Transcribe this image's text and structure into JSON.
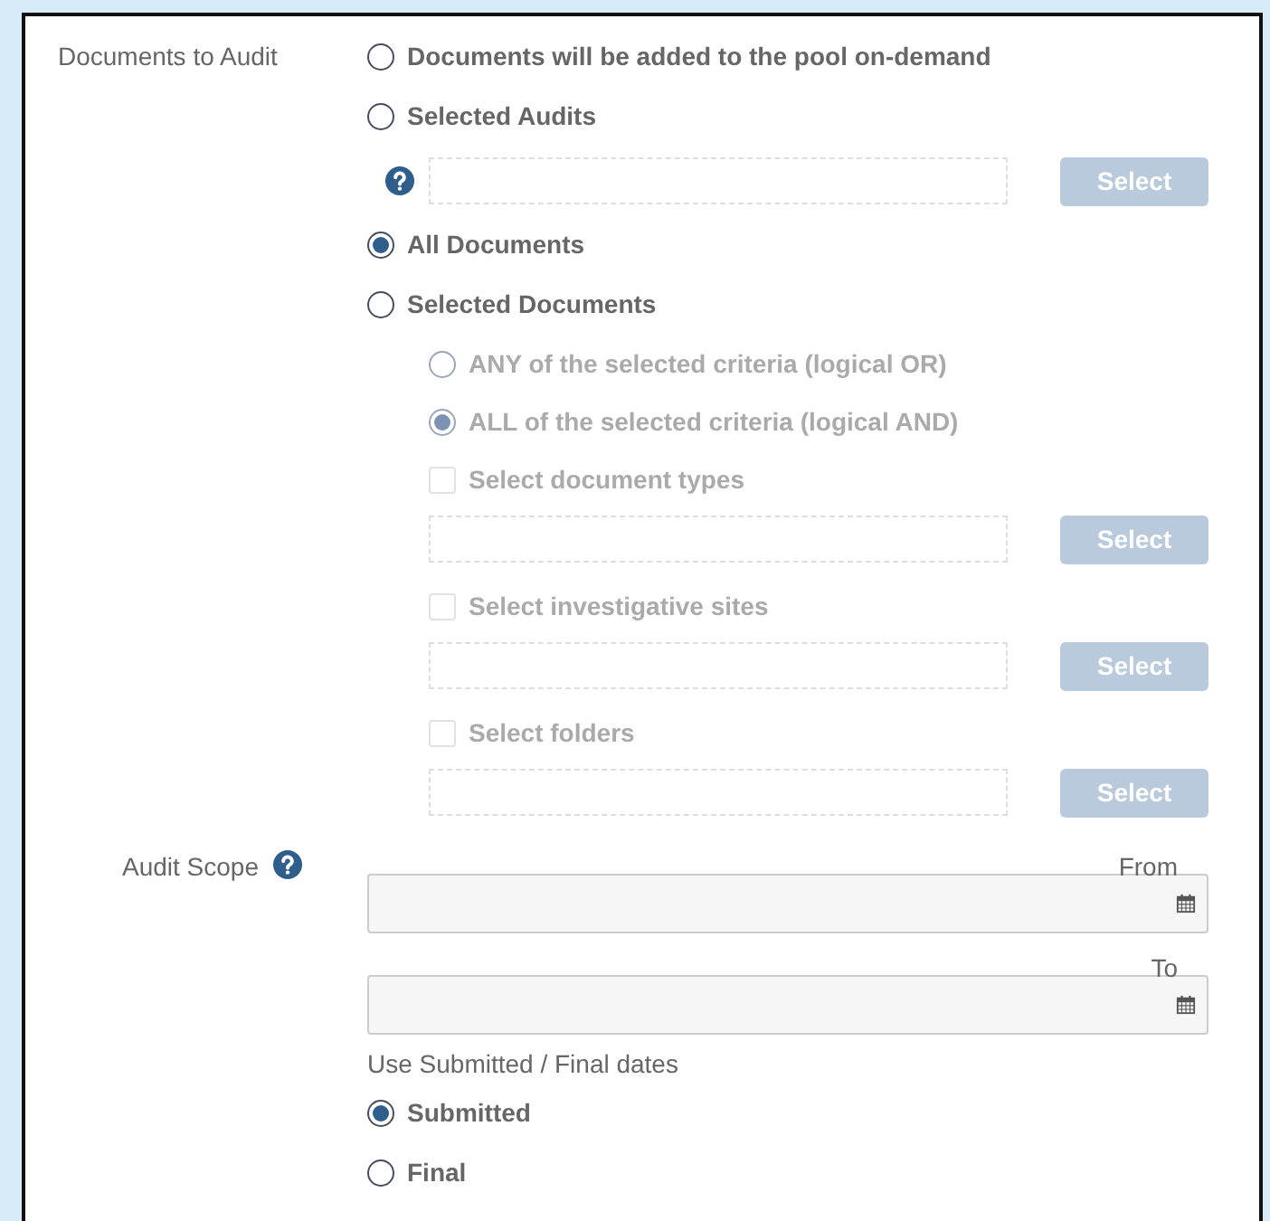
{
  "documents_to_audit": {
    "label": "Documents to Audit",
    "items": [
      {
        "kind": "radio",
        "label": "Documents will be added to the pool on-demand",
        "selected": false,
        "disabled": false
      },
      {
        "kind": "radio",
        "label": "Selected Audits",
        "selected": false,
        "disabled": false
      },
      {
        "kind": "picker",
        "help": true,
        "button": "Select"
      },
      {
        "kind": "radio",
        "label": "All Documents",
        "selected": true,
        "disabled": false
      },
      {
        "kind": "radio",
        "label": "Selected Documents",
        "selected": false,
        "disabled": false
      },
      {
        "kind": "sub-radio",
        "label": "ANY of the selected criteria (logical OR)",
        "selected": false,
        "disabled": true
      },
      {
        "kind": "sub-radio",
        "label": "ALL of the selected criteria (logical AND)",
        "selected": true,
        "disabled": true
      },
      {
        "kind": "checkbox",
        "label": "Select document types",
        "checked": false,
        "disabled": true
      },
      {
        "kind": "sub-picker",
        "help": false,
        "button": "Select"
      },
      {
        "kind": "checkbox",
        "label": "Select investigative sites",
        "checked": false,
        "disabled": true
      },
      {
        "kind": "sub-picker",
        "help": false,
        "button": "Select"
      },
      {
        "kind": "checkbox",
        "label": "Select folders",
        "checked": false,
        "disabled": true
      },
      {
        "kind": "sub-picker",
        "help": false,
        "button": "Select"
      }
    ]
  },
  "audit_scope": {
    "label": "Audit Scope",
    "help": true,
    "from_label": "From",
    "to_label": "To",
    "dates_label": "Use Submitted / Final dates",
    "options": [
      {
        "label": "Submitted",
        "selected": true
      },
      {
        "label": "Final",
        "selected": false
      }
    ]
  }
}
